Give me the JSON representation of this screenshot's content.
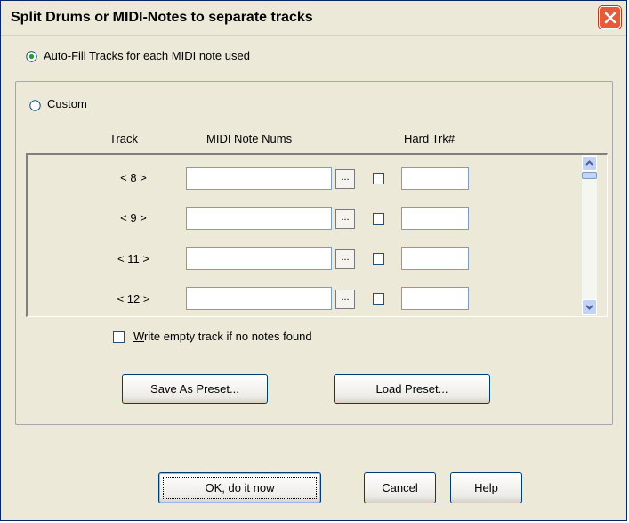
{
  "window": {
    "title": "Split Drums or MIDI-Notes to separate tracks",
    "close_icon": "close-icon"
  },
  "options": {
    "auto_fill_label": "Auto-Fill Tracks for each MIDI note used",
    "auto_fill_selected": true,
    "custom_label": "Custom",
    "custom_selected": false
  },
  "columns": {
    "track": "Track",
    "midi_note_nums": "MIDI Note Nums",
    "hard_trk": "Hard Trk#"
  },
  "rows": [
    {
      "track": "< 8 >",
      "midi_notes": "",
      "dots": "...",
      "hard_checked": false,
      "hard_trk": ""
    },
    {
      "track": "< 9 >",
      "midi_notes": "",
      "dots": "...",
      "hard_checked": false,
      "hard_trk": ""
    },
    {
      "track": "< 11 >",
      "midi_notes": "",
      "dots": "...",
      "hard_checked": false,
      "hard_trk": ""
    },
    {
      "track": "< 12 >",
      "midi_notes": "",
      "dots": "...",
      "hard_checked": false,
      "hard_trk": ""
    }
  ],
  "write_empty": {
    "label_underlined": "W",
    "label_rest": "rite empty track if no notes found",
    "checked": false
  },
  "preset_buttons": {
    "save": "Save As Preset...",
    "load": "Load Preset..."
  },
  "footer": {
    "ok": "OK, do it now",
    "cancel": "Cancel",
    "help": "Help"
  },
  "colors": {
    "face": "#ece9d8",
    "close_red": "#e35b3b",
    "radio_dot": "#21a121"
  }
}
